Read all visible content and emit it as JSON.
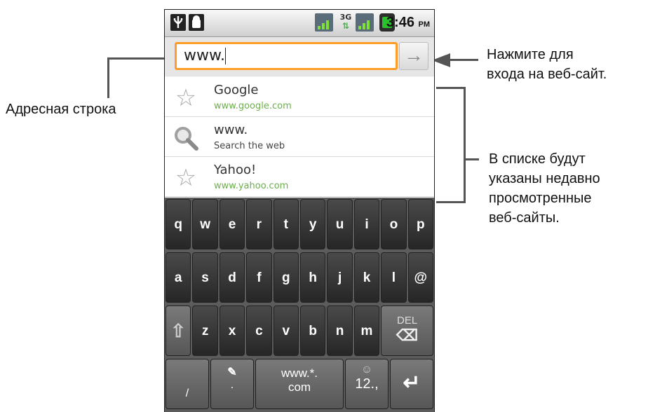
{
  "annotations": {
    "address_bar_label": "Адресная строка",
    "go_hint_line1": "Нажмите для",
    "go_hint_line2": "входа на веб-сайт.",
    "list_hint_line1": "В списке будут",
    "list_hint_line2": "указаны недавно",
    "list_hint_line3": "просмотренные",
    "list_hint_line4": "веб-сайты."
  },
  "status_bar": {
    "network_label": "3G",
    "time": "3:46",
    "ampm": "PM",
    "icons": [
      "usb-icon",
      "android-debug-icon",
      "signal-icon",
      "3g-data-icon",
      "signal-icon",
      "battery-icon"
    ]
  },
  "address_bar": {
    "url_value": "www.",
    "go_icon": "arrow-right-icon"
  },
  "suggestions": [
    {
      "icon": "star-icon",
      "title": "Google",
      "subtitle": "www.google.com"
    },
    {
      "icon": "search-icon",
      "title": "www.",
      "subtitle": "Search the web"
    },
    {
      "icon": "star-icon",
      "title": "Yahoo!",
      "subtitle": "www.yahoo.com"
    }
  ],
  "keyboard": {
    "row1": [
      "q",
      "w",
      "e",
      "r",
      "t",
      "y",
      "u",
      "i",
      "o",
      "p"
    ],
    "row2": [
      "a",
      "s",
      "d",
      "f",
      "g",
      "h",
      "j",
      "k",
      "l",
      "@"
    ],
    "row3": [
      "z",
      "x",
      "c",
      "v",
      "b",
      "n",
      "m"
    ],
    "shift_icon": "shift-arrow-icon",
    "del_label": "DEL",
    "del_icon": "backspace-icon",
    "row4": {
      "slash": "/",
      "period": ".",
      "www_line1": "www.*.",
      "www_line2": "com",
      "symbols_label": "12.,",
      "enter_icon": "enter-icon"
    }
  }
}
